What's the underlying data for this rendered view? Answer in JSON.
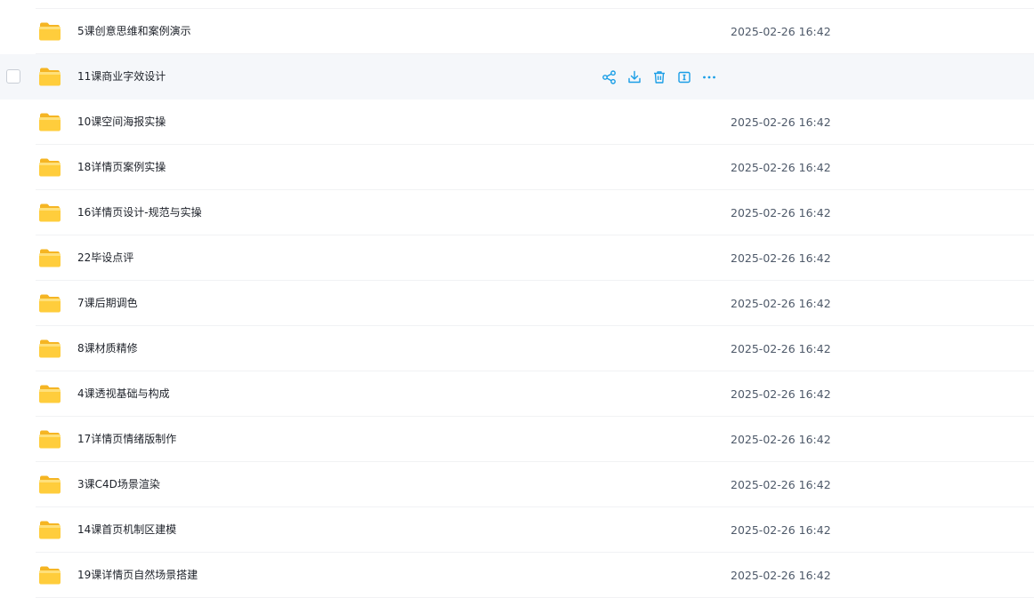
{
  "colors": {
    "accent": "#1a9ee6",
    "folder_yellow": "#ffcd3c",
    "hover_row": "#f5f7fa"
  },
  "hovered_actions": [
    {
      "name": "share-icon"
    },
    {
      "name": "download-icon"
    },
    {
      "name": "delete-icon"
    },
    {
      "name": "rename-icon"
    },
    {
      "name": "more-icon"
    }
  ],
  "files": [
    {
      "name": "5课创意思维和案例演示",
      "time": "2025-02-26 16:42",
      "icon": "folder-icon",
      "hovered": false
    },
    {
      "name": "11课商业字效设计",
      "time": "",
      "icon": "folder-icon",
      "hovered": true
    },
    {
      "name": "10课空间海报实操",
      "time": "2025-02-26 16:42",
      "icon": "folder-icon",
      "hovered": false
    },
    {
      "name": "18详情页案例实操",
      "time": "2025-02-26 16:42",
      "icon": "folder-icon",
      "hovered": false
    },
    {
      "name": "16详情页设计-规范与实操",
      "time": "2025-02-26 16:42",
      "icon": "folder-icon",
      "hovered": false
    },
    {
      "name": "22毕设点评",
      "time": "2025-02-26 16:42",
      "icon": "folder-icon",
      "hovered": false
    },
    {
      "name": "7课后期调色",
      "time": "2025-02-26 16:42",
      "icon": "folder-icon",
      "hovered": false
    },
    {
      "name": "8课材质精修",
      "time": "2025-02-26 16:42",
      "icon": "folder-icon",
      "hovered": false
    },
    {
      "name": "4课透视基础与构成",
      "time": "2025-02-26 16:42",
      "icon": "folder-icon",
      "hovered": false
    },
    {
      "name": "17详情页情绪版制作",
      "time": "2025-02-26 16:42",
      "icon": "folder-icon",
      "hovered": false
    },
    {
      "name": "3课C4D场景渲染",
      "time": "2025-02-26 16:42",
      "icon": "folder-icon",
      "hovered": false
    },
    {
      "name": "14课首页机制区建模",
      "time": "2025-02-26 16:42",
      "icon": "folder-icon",
      "hovered": false
    },
    {
      "name": "19课详情页自然场景搭建",
      "time": "2025-02-26 16:42",
      "icon": "folder-icon",
      "hovered": false
    }
  ]
}
